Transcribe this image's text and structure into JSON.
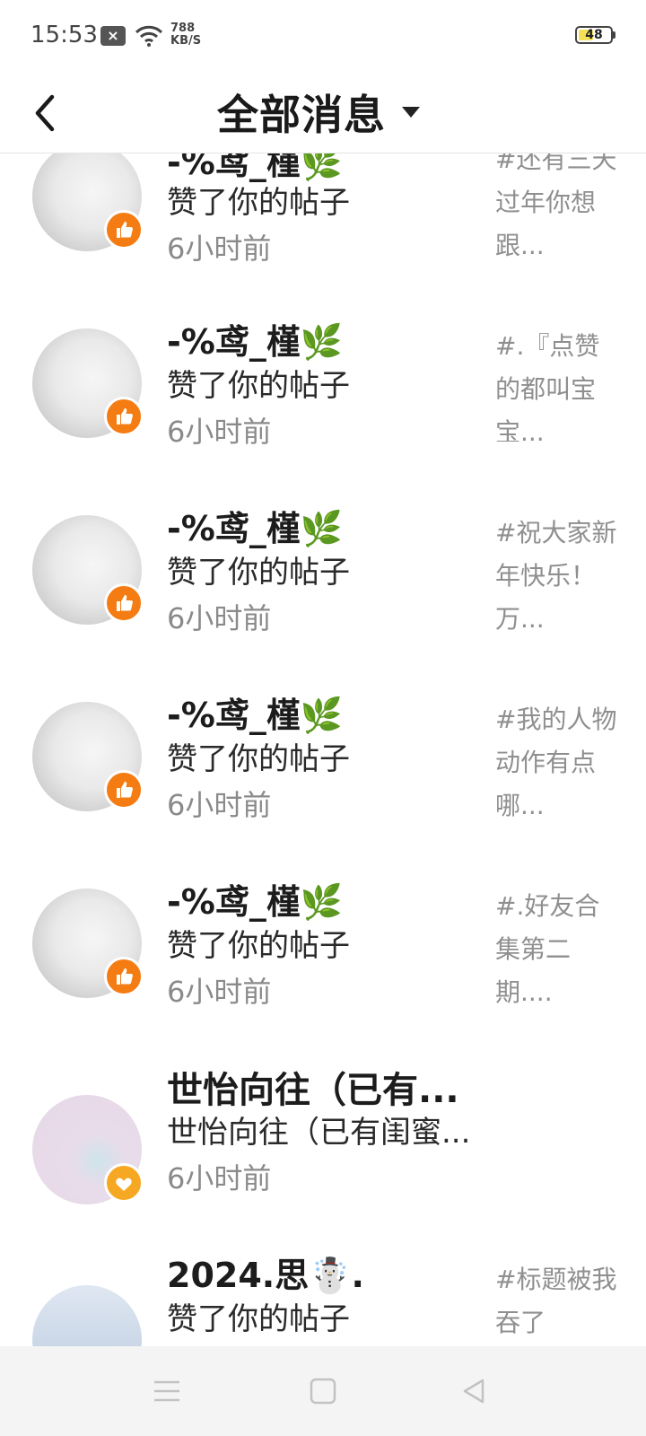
{
  "status_bar": {
    "time": "15:53",
    "notification_icon": "close-box-icon",
    "net_speed_value": "788",
    "net_speed_unit": "KB/S",
    "battery_level": "48",
    "battery_fraction": 0.48
  },
  "header": {
    "title": "全部消息"
  },
  "items": [
    {
      "name": "-%鸢_槿🌿",
      "action": "赞了你的帖子",
      "time": "6小时前",
      "post": "#还有三天过年你想跟...",
      "badge": "like"
    },
    {
      "name": "-%鸢_槿🌿",
      "action": "赞了你的帖子",
      "time": "6小时前",
      "post": "#.『点赞的都叫宝宝...",
      "badge": "like"
    },
    {
      "name": "-%鸢_槿🌿",
      "action": "赞了你的帖子",
      "time": "6小时前",
      "post": "#祝大家新年快乐！万...",
      "badge": "like"
    },
    {
      "name": "-%鸢_槿🌿",
      "action": "赞了你的帖子",
      "time": "6小时前",
      "post": "#我的人物动作有点哪...",
      "badge": "like"
    },
    {
      "name": "-%鸢_槿🌿",
      "action": "赞了你的帖子",
      "time": "6小时前",
      "post": "#.好友合集第二期....",
      "badge": "like"
    },
    {
      "name": "世怡向往（已有...",
      "action": "世怡向往（已有闺蜜...",
      "time": "6小时前",
      "post": "",
      "badge": "heart"
    },
    {
      "name": "2024.思☃️.",
      "action": "赞了你的帖子",
      "time": "",
      "post": "#标题被我吞了",
      "badge": "like"
    }
  ],
  "nav": {
    "menu": "menu-icon",
    "home": "square-home-icon",
    "back": "triangle-back-icon"
  }
}
